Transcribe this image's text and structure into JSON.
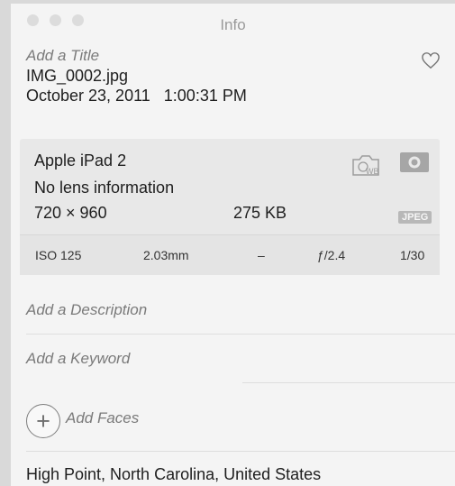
{
  "window": {
    "title": "Info"
  },
  "photo": {
    "title_placeholder": "Add a Title",
    "filename": "IMG_0002.jpg",
    "date": "October 23, 2011",
    "time": "1:00:31 PM"
  },
  "camera": {
    "model": "Apple iPad 2",
    "lens": "No lens information",
    "dimensions": "720 × 960",
    "file_size": "275 KB",
    "format_badge": "JPEG",
    "exif": {
      "iso": "ISO 125",
      "focal_length": "2.03mm",
      "exposure_bias": "–",
      "aperture": "ƒ/2.4",
      "shutter": "1/30"
    }
  },
  "description_placeholder": "Add a Description",
  "keyword_placeholder": "Add a Keyword",
  "faces": {
    "button_glyph": "+",
    "label": "Add Faces"
  },
  "location": "High Point, North Carolina, United States",
  "icons": [
    "heart-icon",
    "white-balance-icon",
    "exposure-icon",
    "add-faces-icon"
  ],
  "colors": {
    "panel_bg": "#f4f4f4",
    "meta_bg": "#e8e8e8",
    "placeholder_text": "#7a7a7a"
  }
}
